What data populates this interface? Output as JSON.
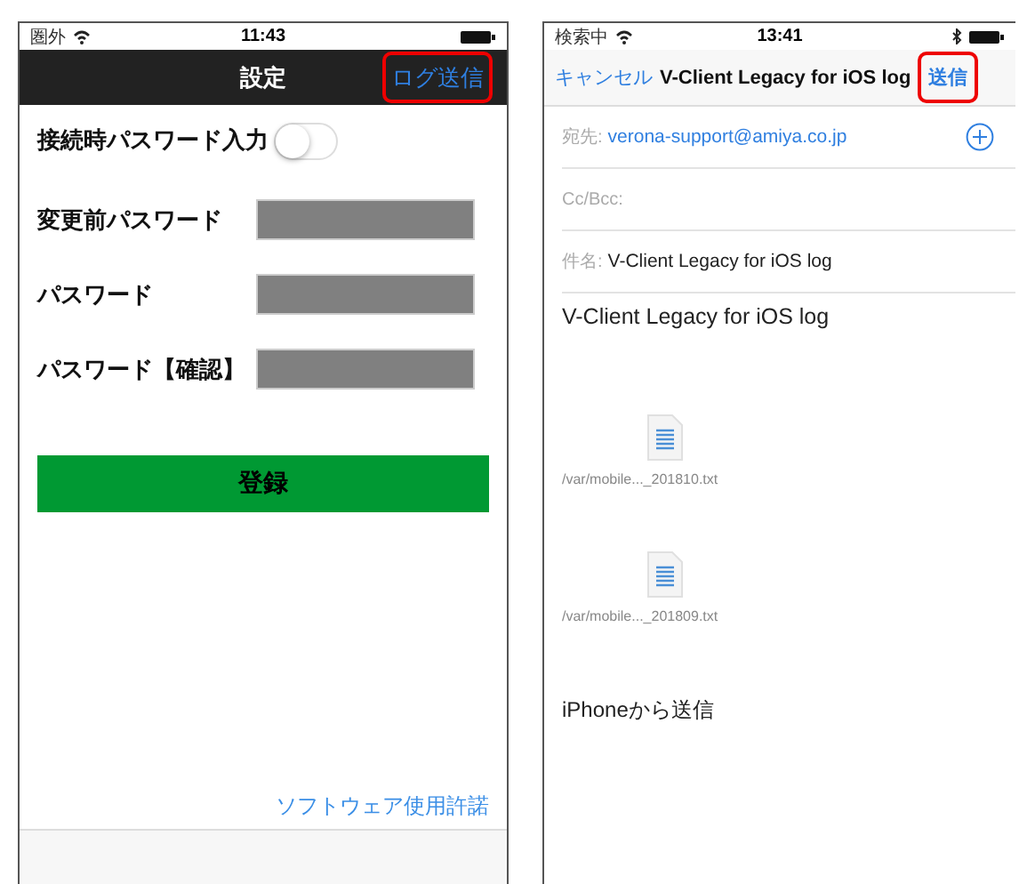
{
  "settings_screen": {
    "status_bar": {
      "carrier": "圏外",
      "time": "11:43"
    },
    "nav": {
      "title": "設定",
      "action": "ログ送信",
      "action_highlighted": true
    },
    "toggle": {
      "label": "接続時パスワード入力",
      "on": false
    },
    "fields": [
      {
        "label": "変更前パスワード"
      },
      {
        "label": "パスワード"
      },
      {
        "label": "パスワード【確認】"
      }
    ],
    "submit": "登録",
    "license_link": "ソフトウェア使用許諾"
  },
  "mail_screen": {
    "status_bar": {
      "carrier": "検索中",
      "time": "13:41"
    },
    "nav": {
      "cancel": "キャンセル",
      "title": "V-Client Legacy for iOS log",
      "send": "送信",
      "send_highlighted": true
    },
    "to_label": "宛先:",
    "to": "verona-support@amiya.co.jp",
    "cc_label": "Cc/Bcc:",
    "subject_label": "件名:",
    "subject": "V-Client Legacy for iOS log",
    "body_title": "V-Client Legacy for iOS log",
    "attachments": [
      {
        "name": "/var/mobile..._201810.txt"
      },
      {
        "name": "/var/mobile..._201809.txt"
      }
    ],
    "signature": "iPhoneから送信"
  }
}
